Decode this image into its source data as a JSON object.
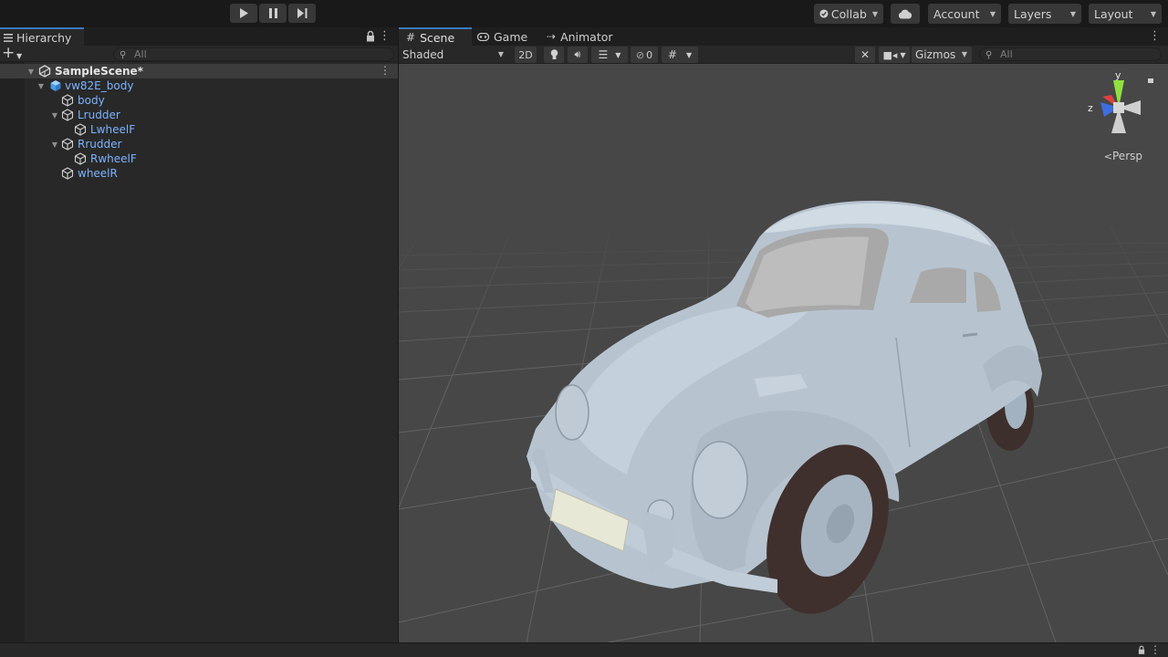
{
  "toolbar": {
    "collab_label": "Collab",
    "account_label": "Account",
    "layers_label": "Layers",
    "layout_label": "Layout"
  },
  "hierarchy": {
    "tab_label": "Hierarchy",
    "search_placeholder": "All",
    "items": [
      {
        "label": "SampleScene*",
        "kind": "scene"
      },
      {
        "label": "vw82E_body",
        "kind": "prefab"
      },
      {
        "label": "body",
        "kind": "object"
      },
      {
        "label": "Lrudder",
        "kind": "object"
      },
      {
        "label": "LwheelF",
        "kind": "object"
      },
      {
        "label": "Rrudder",
        "kind": "object"
      },
      {
        "label": "RwheelF",
        "kind": "object"
      },
      {
        "label": "wheelR",
        "kind": "object"
      }
    ]
  },
  "scene": {
    "tabs": [
      "Scene",
      "Game",
      "Animator"
    ],
    "active_tab": "Scene",
    "shading_mode": "Shaded",
    "mode_2d_label": "2D",
    "hidden_count": "0",
    "gizmos_label": "Gizmos",
    "search_placeholder": "All",
    "projection_label": "Persp",
    "gizmo_axes": {
      "y": "y",
      "z": "z"
    }
  },
  "colors": {
    "accent": "#3a79bb",
    "object_label": "#7cb3ff",
    "panel_bg": "#282828",
    "viewport_bg": "#474747",
    "car_body": "#b9c6d2"
  }
}
